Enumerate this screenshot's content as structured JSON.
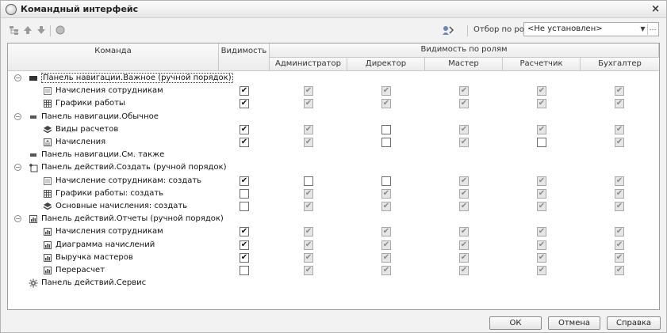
{
  "window": {
    "title": "Командный интерфейс",
    "close_glyph": "×"
  },
  "toolbar": {
    "icons": [
      "tree-icon",
      "move-up-icon",
      "move-down-icon",
      "reset-icon",
      "role-filter-icon"
    ],
    "filter_label": "Отбор по ролям:",
    "filter_value": "<Не установлен>"
  },
  "table": {
    "headers": {
      "command": "Команда",
      "visibility": "Видимость",
      "roles_group": "Видимость по ролям",
      "roles": [
        "Администратор",
        "Директор",
        "Мастер",
        "Расчетчик",
        "Бухгалтер"
      ]
    },
    "rows": [
      {
        "level": 0,
        "toggle": "⊖",
        "icon": "navpanel-icon",
        "label": "Панель навигации.Важное (ручной порядок)",
        "selected": true
      },
      {
        "level": 1,
        "icon": "doc-icon",
        "label": "Начисления сотрудникам",
        "vis": true,
        "roles": [
          true,
          true,
          true,
          true,
          true
        ]
      },
      {
        "level": 1,
        "icon": "grid-icon",
        "label": "Графики работы",
        "vis": true,
        "roles": [
          true,
          true,
          true,
          true,
          true
        ]
      },
      {
        "level": 0,
        "toggle": "⊖",
        "icon": "navpanel-small-icon",
        "label": "Панель навигации.Обычное"
      },
      {
        "level": 1,
        "icon": "stack-icon",
        "label": "Виды расчетов",
        "vis": true,
        "roles": [
          true,
          false,
          true,
          true,
          true
        ]
      },
      {
        "level": 1,
        "icon": "document-icon",
        "label": "Начисления",
        "vis": true,
        "roles": [
          true,
          false,
          true,
          false,
          true
        ]
      },
      {
        "level": 0,
        "icon": "navpanel-small-icon",
        "label": "Панель навигации.См. также"
      },
      {
        "level": 0,
        "toggle": "⊖",
        "icon": "new-doc-icon",
        "label": "Панель действий.Создать (ручной порядок)"
      },
      {
        "level": 1,
        "icon": "doc-icon",
        "label": "Начисление сотрудникам: создать",
        "vis": true,
        "roles": [
          false,
          false,
          true,
          true,
          true
        ]
      },
      {
        "level": 1,
        "icon": "grid-icon",
        "label": "Графики работы: создать",
        "vis": false,
        "roles": [
          true,
          true,
          true,
          true,
          true
        ]
      },
      {
        "level": 1,
        "icon": "stack-icon",
        "label": "Основные начисления: создать",
        "vis": false,
        "roles": [
          true,
          true,
          true,
          true,
          true
        ]
      },
      {
        "level": 0,
        "toggle": "⊖",
        "icon": "report-icon",
        "label": "Панель действий.Отчеты (ручной порядок)"
      },
      {
        "level": 1,
        "icon": "report-icon",
        "label": "Начисления сотрудникам",
        "vis": true,
        "roles": [
          true,
          true,
          true,
          true,
          true
        ]
      },
      {
        "level": 1,
        "icon": "report-icon",
        "label": "Диаграмма начислений",
        "vis": true,
        "roles": [
          true,
          true,
          true,
          true,
          true
        ]
      },
      {
        "level": 1,
        "icon": "report-icon",
        "label": "Выручка мастеров",
        "vis": true,
        "roles": [
          true,
          true,
          true,
          true,
          true
        ]
      },
      {
        "level": 1,
        "icon": "report-icon",
        "label": "Перерасчет",
        "vis": false,
        "roles": [
          true,
          true,
          true,
          true,
          true
        ]
      },
      {
        "level": 0,
        "icon": "gear-icon",
        "label": "Панель действий.Сервис"
      }
    ]
  },
  "buttons": {
    "ok": "ОК",
    "cancel": "Отмена",
    "help": "Справка"
  },
  "colors": {
    "header_bg": "#ececec",
    "border": "#9c9c9c"
  }
}
